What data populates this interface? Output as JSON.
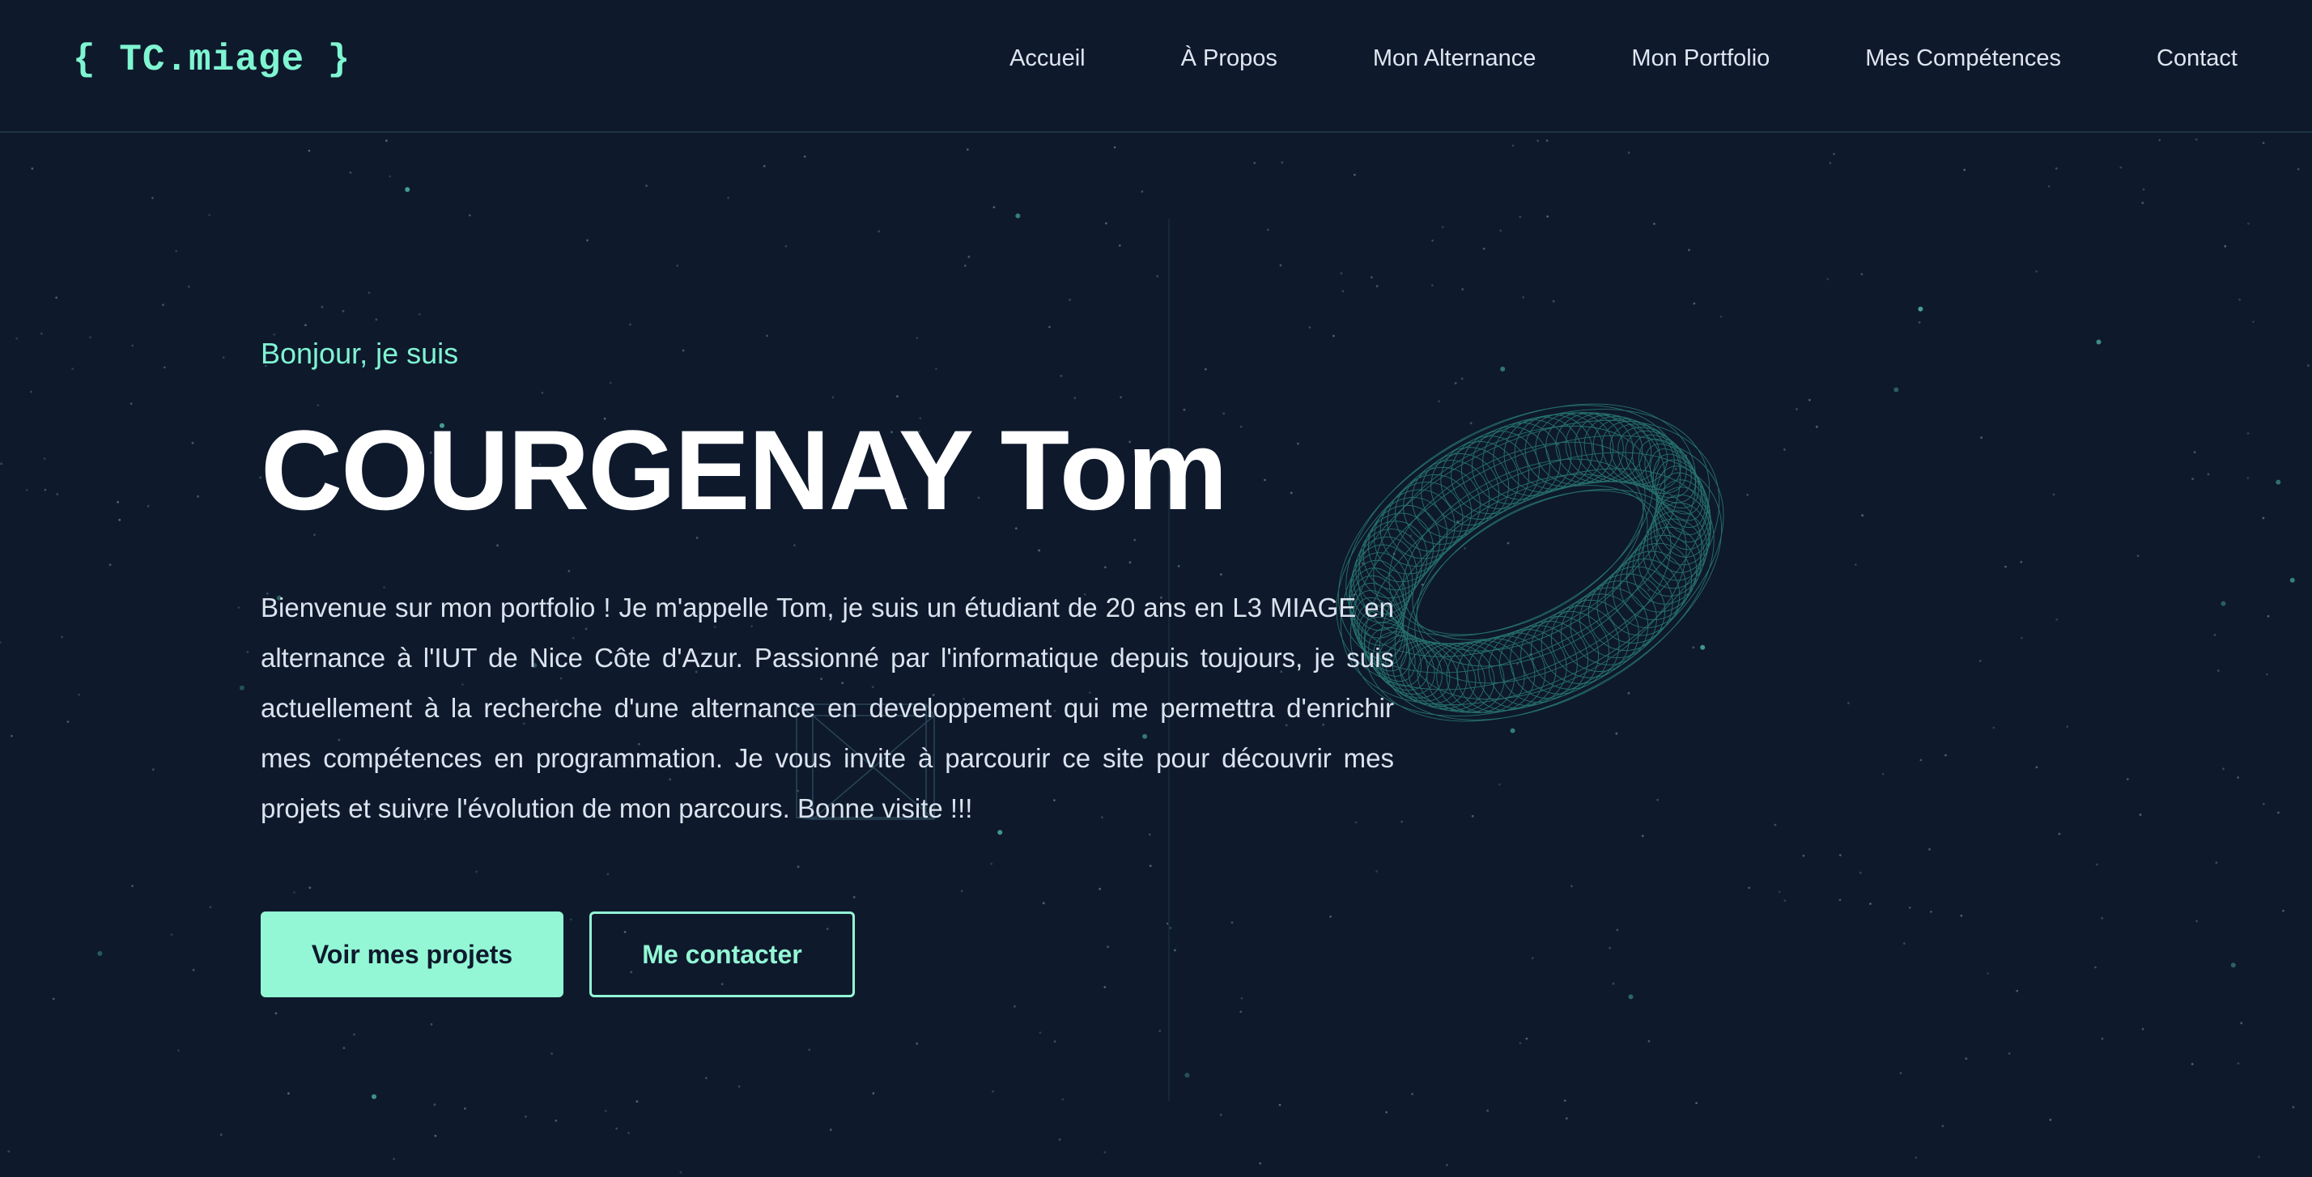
{
  "logo": {
    "text": "{ TC.miage }"
  },
  "nav": {
    "items": [
      {
        "label": "Accueil"
      },
      {
        "label": "À Propos"
      },
      {
        "label": "Mon Alternance"
      },
      {
        "label": "Mon Portfolio"
      },
      {
        "label": "Mes Compétences"
      },
      {
        "label": "Contact"
      }
    ]
  },
  "hero": {
    "greeting": "Bonjour, je suis",
    "name": "COURGENAY Tom",
    "intro": "Bienvenue sur mon portfolio ! Je m'appelle Tom, je suis un étudiant de 20 ans en L3 MIAGE en alternance à l'IUT de Nice Côte d'Azur. Passionné par l'informatique depuis toujours, je suis actuellement à la recherche d'une alternance en developpement qui me permettra d'enrichir mes compétences en programmation. Je vous invite à parcourir ce site pour découvrir mes projets et suivre l'évolution de mon parcours. Bonne visite !!!",
    "primary_button": "Voir mes projets",
    "secondary_button": "Me contacter"
  },
  "colors": {
    "background": "#0e192c",
    "accent": "#7ff5d1",
    "button_fill": "#93f7d5",
    "text": "#dbe3ee",
    "heading": "#ffffff"
  },
  "icons": {
    "torus": "torus-wireframe-icon",
    "wirebox": "wireframe-box-icon"
  }
}
